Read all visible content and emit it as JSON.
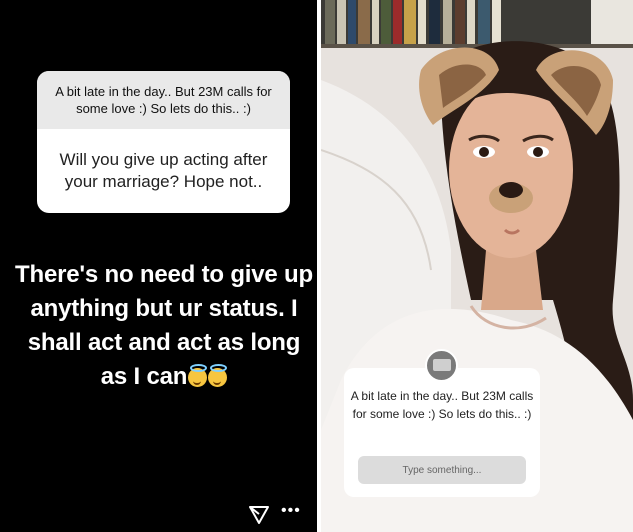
{
  "left_story": {
    "question_header": "A bit late in the day.. But 23M calls for some love :) So lets do this.. :)",
    "question": "Will you give up acting after your marriage? Hope not..",
    "answer": "There's no need to give up anything but ur status. I shall act and act as long as I can",
    "emoji_icons": [
      "smiling-face-with-halo-icon",
      "smiling-face-with-halo-icon"
    ],
    "footer_icons": [
      "send-icon",
      "more-icon"
    ],
    "more_glyph": "•••"
  },
  "right_story": {
    "sticker_text": "A bit late in the day.. But 23M calls for some love :) So lets do this.. :)",
    "input_placeholder": "Type something..."
  },
  "colors": {
    "left_background": "#000000",
    "card_header": "#e9e9e9",
    "card_body": "#ffffff",
    "input_background": "#dcdcdc"
  }
}
